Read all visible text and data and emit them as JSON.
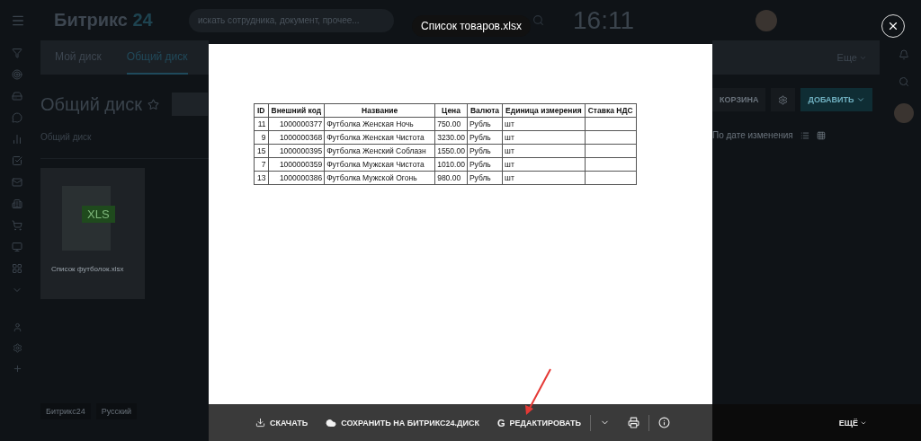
{
  "header": {
    "logo": "Битрикс",
    "logo_suffix": "24",
    "search": {
      "placeholder": "искать сотрудника, документ, прочее..."
    },
    "clock": "16:11"
  },
  "tabs": [
    {
      "label": "Мой диск",
      "selected": false
    },
    {
      "label": "Общий диск",
      "selected": true
    }
  ],
  "more_menu": "Еще",
  "page": {
    "title": "Общий диск",
    "breadcrumb": "Общий диск",
    "sort": "По дате изменения"
  },
  "actions": [
    {
      "label": "КОРЗИНА",
      "kind": "plain"
    },
    {
      "kind": "settings"
    },
    {
      "label": "ДОБАВИТЬ",
      "kind": "primary"
    }
  ],
  "files": [
    {
      "name": "Список футболок.xlsx",
      "type": "XLS"
    }
  ],
  "footer": [
    "Битрикс24",
    "Русский"
  ],
  "viewer": {
    "title": "Список товаров.xlsx",
    "sheet": {
      "columns": [
        "ID",
        "Внешний код",
        "Название",
        "Цена",
        "Валюта",
        "Единица измерения",
        "Ставка НДС"
      ],
      "rows": [
        [
          "11",
          "1000000377",
          "Футболка Женская Ночь",
          "750.00",
          "Рубль",
          "шт",
          ""
        ],
        [
          "9",
          "1000000368",
          "Футболка Женская Чистота",
          "3230.00",
          "Рубль",
          "шт",
          ""
        ],
        [
          "15",
          "1000000395",
          "Футболка Женский Соблазн",
          "1550.00",
          "Рубль",
          "шт",
          ""
        ],
        [
          "7",
          "1000000359",
          "Футболка Мужская Чистота",
          "1010.00",
          "Рубль",
          "шт",
          ""
        ],
        [
          "13",
          "1000000386",
          "Футболка Мужской Огонь",
          "980.00",
          "Рубль",
          "шт",
          ""
        ]
      ]
    },
    "toolbar": [
      {
        "label": "СКАЧАТЬ",
        "kind": "download"
      },
      {
        "label": "СОХРАНИТЬ НА БИТРИКС24.ДИСК",
        "kind": "cloud"
      },
      {
        "label": "РЕДАКТИРОВАТЬ",
        "kind": "edit",
        "icon": "G"
      },
      {
        "kind": "dropdown"
      },
      {
        "kind": "print"
      },
      {
        "kind": "info"
      }
    ],
    "more": "ЕЩЁ"
  }
}
